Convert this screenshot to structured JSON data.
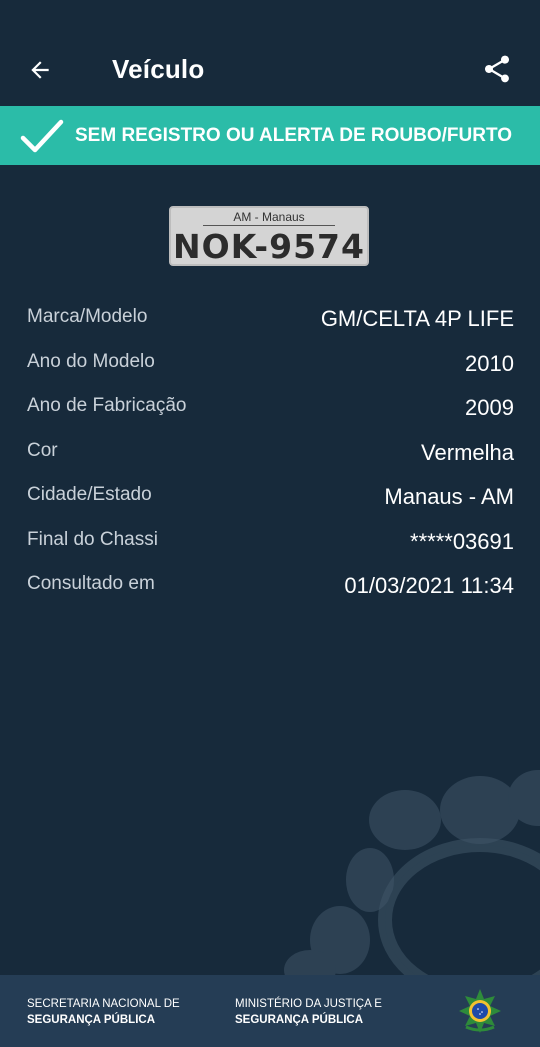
{
  "header": {
    "title": "Veículo",
    "back_icon": "arrow-left-icon",
    "share_icon": "share-icon"
  },
  "status_banner": {
    "text": "SEM REGISTRO OU ALERTA DE ROUBO/FURTO",
    "icon": "check-icon",
    "color": "#2bbca8"
  },
  "plate": {
    "region": "AM - Manaus",
    "number": "NOK-9574"
  },
  "details": [
    {
      "label": "Marca/Modelo",
      "value": "GM/CELTA 4P LIFE"
    },
    {
      "label": "Ano do Modelo",
      "value": "2010"
    },
    {
      "label": "Ano de Fabricação",
      "value": "2009"
    },
    {
      "label": "Cor",
      "value": "Vermelha"
    },
    {
      "label": "Cidade/Estado",
      "value": "Manaus - AM"
    },
    {
      "label": "Final do Chassi",
      "value": "*****03691"
    },
    {
      "label": "Consultado em",
      "value": "01/03/2021 11:34"
    }
  ],
  "footer": {
    "left_line1": "SECRETARIA NACIONAL DE",
    "left_line2": "SEGURANÇA PÚBLICA",
    "right_line1": "MINISTÉRIO DA JUSTIÇA E",
    "right_line2": "SEGURANÇA PÚBLICA",
    "emblem_icon": "brazil-coat-of-arms-icon"
  },
  "colors": {
    "background": "#172a3b",
    "footer": "#253d55",
    "accent": "#2bbca8"
  }
}
